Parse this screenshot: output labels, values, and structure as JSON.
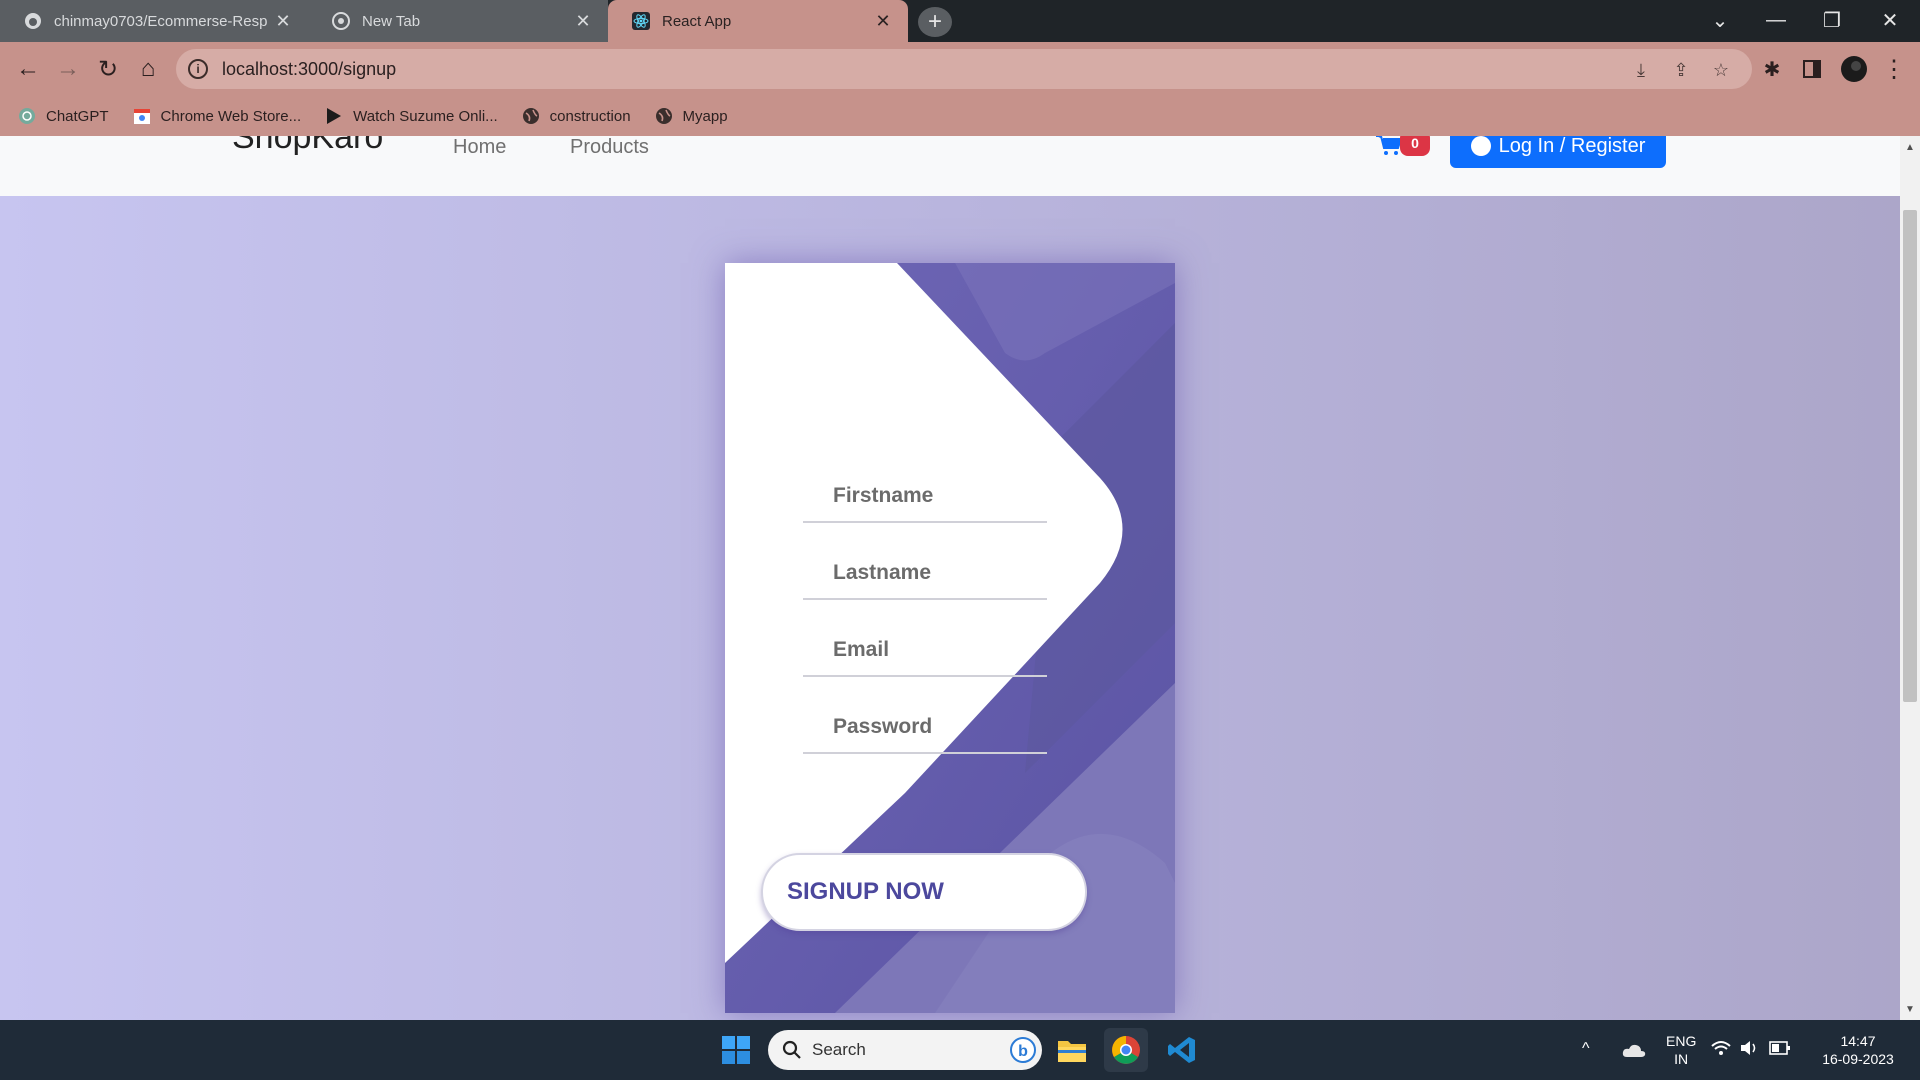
{
  "browser": {
    "tabs": [
      {
        "title": "chinmay0703/Ecommerse-Resp",
        "icon": "github-icon",
        "active": false
      },
      {
        "title": "New Tab",
        "icon": "chrome-icon",
        "active": false
      },
      {
        "title": "React App",
        "icon": "react-icon",
        "active": true
      }
    ],
    "url": "localhost:3000/signup",
    "bookmarks": [
      {
        "label": "ChatGPT",
        "icon": "chatgpt-icon"
      },
      {
        "label": "Chrome Web Store...",
        "icon": "webstore-icon"
      },
      {
        "label": "Watch Suzume Onli...",
        "icon": "play-icon"
      },
      {
        "label": "construction",
        "icon": "globe-icon"
      },
      {
        "label": "Myapp",
        "icon": "globe-icon"
      }
    ]
  },
  "navbar": {
    "brand": "ShopKaro",
    "links": [
      "Home",
      "Products"
    ],
    "cart_count": "0",
    "login_label": "Log In / Register"
  },
  "signup_form": {
    "fields": [
      {
        "name": "firstname",
        "placeholder": "Firstname"
      },
      {
        "name": "lastname",
        "placeholder": "Lastname"
      },
      {
        "name": "email",
        "placeholder": "Email"
      },
      {
        "name": "password",
        "placeholder": "Password"
      }
    ],
    "submit_label": "Signup Now"
  },
  "taskbar": {
    "search_label": "Search",
    "language": "ENG",
    "region": "IN",
    "time": "14:47",
    "date": "16-09-2023"
  },
  "colors": {
    "card_purple": "#6a62b0",
    "card_dark": "#5c55a5",
    "accent_text": "#4c489d",
    "login_blue": "#0d6efd",
    "badge_red": "#dc3545",
    "browser_frame": "#c6928b"
  }
}
